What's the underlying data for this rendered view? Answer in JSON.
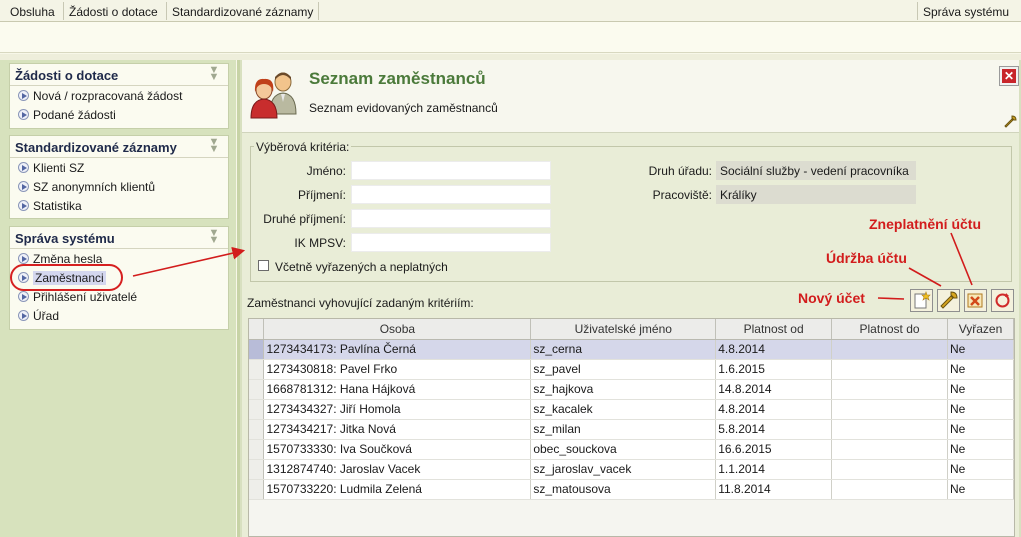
{
  "menubar": {
    "items": [
      "Obsluha",
      "Žádosti o dotace",
      "Standardizované záznamy"
    ],
    "right": "Správa systému"
  },
  "sidebar": {
    "sections": [
      {
        "title": "Žádosti o dotace",
        "items": [
          "Nová / rozpracovaná žádost",
          "Podané žádosti"
        ]
      },
      {
        "title": "Standardizované záznamy",
        "items": [
          "Klienti SZ",
          "SZ anonymních klientů",
          "Statistika"
        ]
      },
      {
        "title": "Správa systému",
        "items": [
          "Změna hesla",
          "Zaměstnanci",
          "Přihlášení uživatelé",
          "Úřad"
        ]
      }
    ]
  },
  "header": {
    "title": "Seznam zaměstnanců",
    "subtitle": "Seznam evidovaných zaměstnanců"
  },
  "filter": {
    "legend": "Výběrová kritéria:",
    "jmeno_label": "Jméno:",
    "jmeno_value": "",
    "prijmeni_label": "Příjmení:",
    "prijmeni_value": "",
    "druhe_prijmeni_label": "Druhé příjmení:",
    "druhe_prijmeni_value": "",
    "ikmpsv_label": "IK MPSV:",
    "ikmpsv_value": "",
    "druh_uradu_label": "Druh úřadu:",
    "druh_uradu_value": "Sociální služby - vedení pracovníka",
    "pracoviste_label": "Pracoviště:",
    "pracoviste_value": "Králíky",
    "checkbox_label": "Včetně vyřazených a neplatných"
  },
  "grid": {
    "caption": "Zaměstnanci vyhovující zadaným kritériím:",
    "columns": [
      "Osoba",
      "Uživatelské jméno",
      "Platnost od",
      "Platnost do",
      "Vyřazen"
    ],
    "rows": [
      [
        "1273434173: Pavlína Černá",
        "sz_cerna",
        "4.8.2014",
        "",
        "Ne"
      ],
      [
        "1273430818: Pavel Frko",
        "sz_pavel",
        "1.6.2015",
        "",
        "Ne"
      ],
      [
        "1668781312: Hana Hájková",
        "sz_hajkova",
        "14.8.2014",
        "",
        "Ne"
      ],
      [
        "1273434327: Jiří Homola",
        "sz_kacalek",
        "4.8.2014",
        "",
        "Ne"
      ],
      [
        "1273434217: Jitka Nová",
        "sz_milan",
        "5.8.2014",
        "",
        "Ne"
      ],
      [
        "1570733330: Iva Součková",
        "obec_souckova",
        "16.6.2015",
        "",
        "Ne"
      ],
      [
        "1312874740: Jaroslav Vacek",
        "sz_jaroslav_vacek",
        "1.1.2014",
        "",
        "Ne"
      ],
      [
        "1570733220: Ludmila Zelená",
        "sz_matousova",
        "11.8.2014",
        "",
        "Ne"
      ]
    ]
  },
  "annotations": {
    "new_account": "Nový účet",
    "maintenance": "Údržba účtu",
    "invalidate": "Zneplatnění účtu"
  },
  "colors": {
    "accent_green": "#4b7a3a",
    "sidebar_bg": "#d7e2bd",
    "annotation_red": "#d21c1c"
  }
}
